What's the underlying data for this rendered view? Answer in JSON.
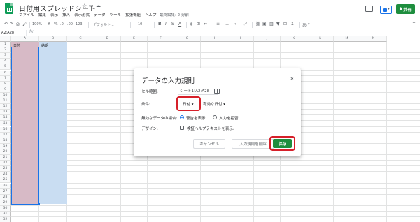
{
  "app": {
    "title": "日付用スプレッドシート",
    "menu": [
      "ファイル",
      "編集",
      "表示",
      "挿入",
      "表示形式",
      "データ",
      "ツール",
      "拡張機能",
      "ヘルプ"
    ],
    "last_edit": "最終編集: 2 分前",
    "share_label": "共有",
    "share_icon": "lock-icon",
    "accent_color": "#1e8e3e"
  },
  "toolbar": {
    "zoom": "100%",
    "currency": "¥",
    "percent": "%",
    "decimal_dec": ".0",
    "decimal_inc": ".00",
    "number_format": "123",
    "font": "デフォルト...",
    "font_size": "10",
    "bold": "B",
    "italic": "I",
    "strike": "S",
    "text_color": "A",
    "more": "あ",
    "more_arrow": "▾",
    "collapse": "^"
  },
  "formula": {
    "name_box": "A2:A28",
    "fx": "fx"
  },
  "grid": {
    "columns": [
      "A",
      "B",
      "C",
      "D",
      "E",
      "F",
      "G",
      "H",
      "I",
      "J",
      "K",
      "L",
      "M",
      "N"
    ],
    "rows": [
      "1",
      "2",
      "3",
      "4",
      "5",
      "6",
      "7",
      "8",
      "9",
      "10",
      "11",
      "12",
      "13",
      "14",
      "15",
      "16",
      "17",
      "18",
      "19",
      "20",
      "21",
      "22",
      "23",
      "24",
      "25",
      "26",
      "27",
      "28",
      "29",
      "30",
      "31",
      "32"
    ],
    "cells": {
      "A1": "日付",
      "B1": "納期"
    }
  },
  "dialog": {
    "title": "データの入力規則",
    "close": "×",
    "range_label": "セル範囲:",
    "range_value": "シート1!A2:A28",
    "criteria_label": "条件:",
    "criteria_value": "日付",
    "condition_value": "有効な日付",
    "invalid_label": "無効なデータの場合:",
    "invalid_options": [
      "警告を表示",
      "入力を拒否"
    ],
    "invalid_selected": "警告を表示",
    "design_label": "デザイン:",
    "help_text_label": "検証ヘルプテキストを表示:",
    "cancel": "キャンセル",
    "remove": "入力規則を削除",
    "save": "保存",
    "highlight_color": "#d6202a"
  }
}
